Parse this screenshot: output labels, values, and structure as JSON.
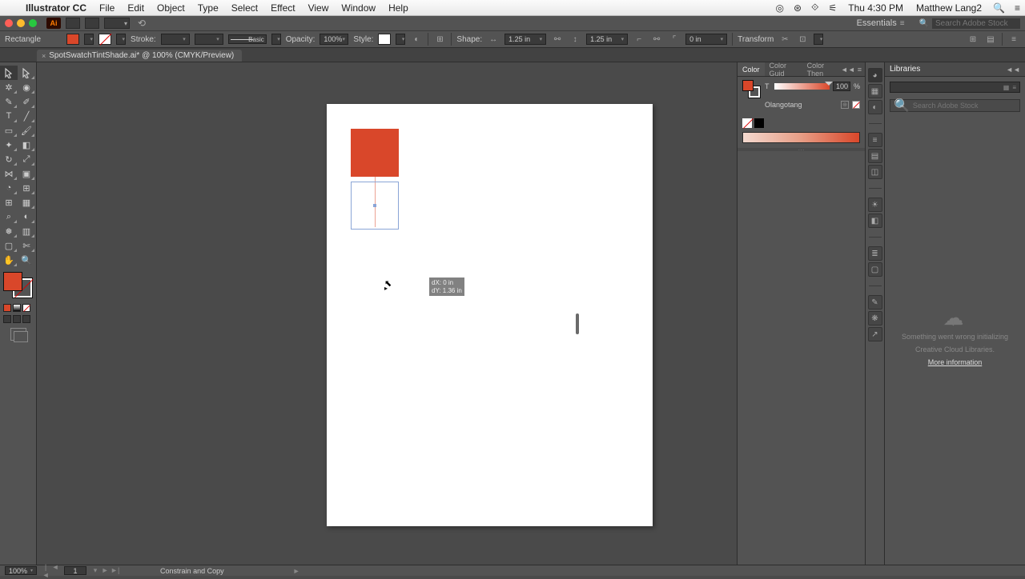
{
  "menubar": {
    "app": "Illustrator CC",
    "items": [
      "File",
      "Edit",
      "Object",
      "Type",
      "Select",
      "Effect",
      "View",
      "Window",
      "Help"
    ],
    "time": "Thu 4:30 PM",
    "user": "Matthew Lang2"
  },
  "header": {
    "workspace": "Essentials",
    "stock_placeholder": "Search Adobe Stock"
  },
  "control": {
    "tool": "Rectangle",
    "stroke_label": "Stroke:",
    "stroke_weight": "",
    "brush": "Basic",
    "opacity_label": "Opacity:",
    "opacity": "100%",
    "style_label": "Style:",
    "shape_label": "Shape:",
    "w": "1.25 in",
    "h": "1.25 in",
    "corner": "0 in",
    "transform": "Transform"
  },
  "tab": {
    "title": "SpotSwatchTintShade.ai* @ 100% (CMYK/Preview)"
  },
  "color_panel": {
    "tabs": [
      "Color",
      "Color Guid",
      "Color Then"
    ],
    "tint_label": "T",
    "tint_value": "100",
    "tint_pct": "%",
    "swatch_name": "Olangotang"
  },
  "libraries": {
    "title": "Libraries",
    "search_placeholder": "Search Adobe Stock",
    "error1": "Something went wrong initializing",
    "error2": "Creative Cloud Libraries.",
    "link": "More information"
  },
  "canvas": {
    "dx": "dX: 0 in",
    "dy": "dY: 1.36 in"
  },
  "status": {
    "zoom": "100%",
    "artboard": "1",
    "mode": "Constrain and Copy"
  }
}
